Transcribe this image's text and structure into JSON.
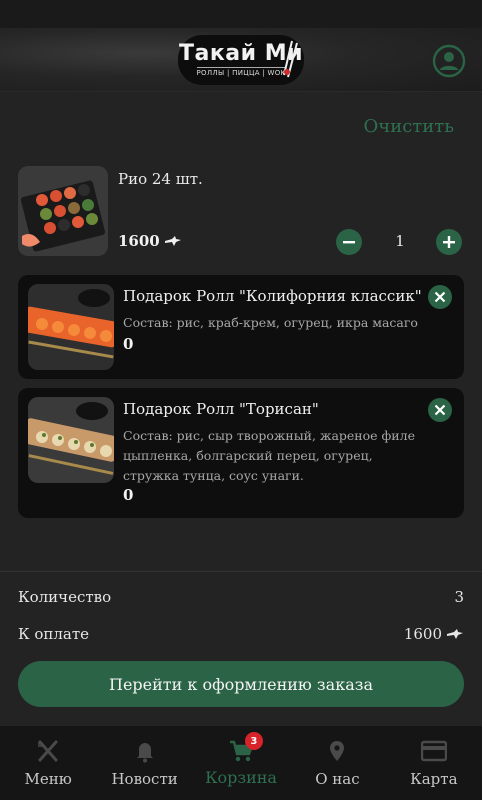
{
  "header": {
    "logo_title": "Такай Ми",
    "logo_subtitle": "РОЛЛЫ | ПИЦЦА | WOK"
  },
  "cart": {
    "clear_label": "Очистить",
    "item": {
      "name": "Рио 24 шт.",
      "price": "1600",
      "quantity": "1"
    }
  },
  "gifts": [
    {
      "name": "Подарок Ролл \"Колифорния классик\"",
      "description": "Состав: рис, краб-крем, огурец, икра масаго",
      "price": "0"
    },
    {
      "name": "Подарок Ролл \"Торисан\"",
      "description": "Состав: рис, сыр творожный, жареное филе цыпленка, болгарский перец, огурец, стружка тунца, соус унаги.",
      "price": "0"
    }
  ],
  "summary": {
    "quantity_label": "Количество",
    "quantity_value": "3",
    "total_label": "К оплате",
    "total_value": "1600"
  },
  "checkout_label": "Перейти к оформлению заказа",
  "nav": {
    "items": [
      {
        "label": "Меню",
        "icon": "fork-knife-icon"
      },
      {
        "label": "Новости",
        "icon": "bell-icon"
      },
      {
        "label": "Корзина",
        "icon": "cart-icon",
        "badge": "3"
      },
      {
        "label": "О нас",
        "icon": "location-pin-icon"
      },
      {
        "label": "Карта",
        "icon": "credit-card-icon"
      }
    ]
  },
  "colors": {
    "accent": "#2a6346",
    "accent_text": "#2f7050",
    "background": "#232323",
    "card": "#0e0e0e",
    "badge": "#d6242a"
  }
}
